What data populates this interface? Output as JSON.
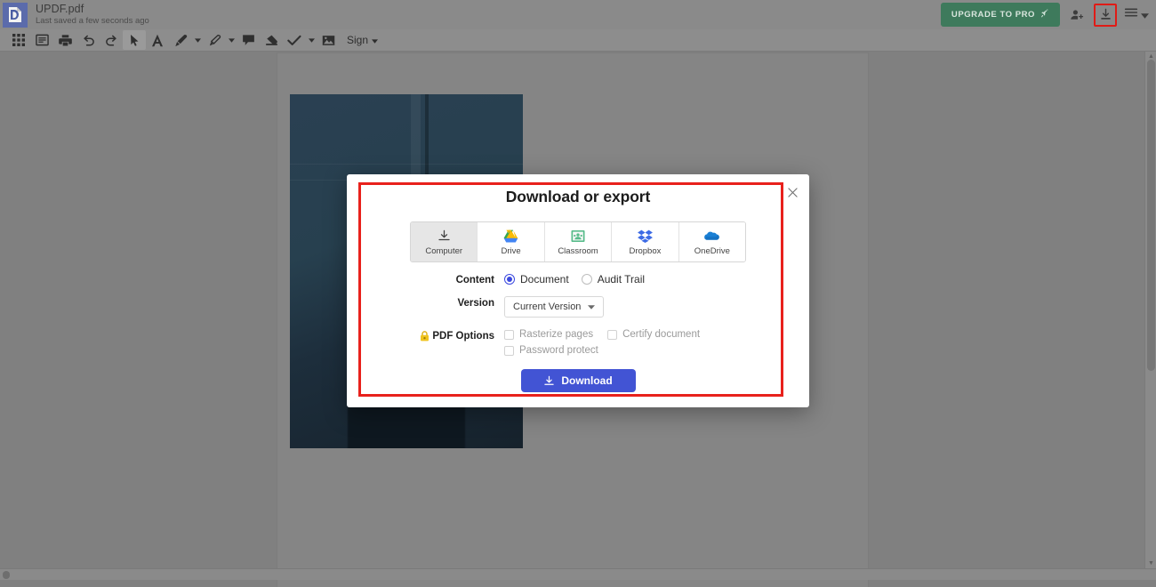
{
  "app": {
    "logo_icon": "dochub-logo-icon",
    "document_title": "UPDF.pdf",
    "save_status": "Last saved a few seconds ago",
    "upgrade_label": "UPGRADE TO PRO",
    "upgrade_icon": "rocket-icon",
    "upgrade_color": "#3e7a5c",
    "share_icon": "add-person-icon",
    "download_icon": "download-icon",
    "menu_icon": "hamburger-menu-icon",
    "menu_caret_icon": "chevron-down-icon",
    "highlight_color": "#e8211c"
  },
  "toolbar": {
    "items": [
      {
        "icon": "grid-thumbnails-icon",
        "label": "Page thumbnails",
        "selected": false,
        "caret": false
      },
      {
        "icon": "page-list-icon",
        "label": "Page list",
        "selected": false,
        "caret": false
      },
      {
        "icon": "printer-icon",
        "label": "Print",
        "selected": false,
        "caret": false
      },
      {
        "icon": "undo-icon",
        "label": "Undo",
        "selected": false,
        "caret": false
      },
      {
        "icon": "redo-icon",
        "label": "Redo",
        "selected": false,
        "caret": false
      },
      {
        "icon": "cursor-arrow-icon",
        "label": "Select",
        "selected": true,
        "caret": false
      },
      {
        "icon": "text-tool-icon",
        "label": "Text",
        "selected": false,
        "caret": false
      },
      {
        "icon": "marker-pen-icon",
        "label": "Draw",
        "selected": false,
        "caret": true
      },
      {
        "icon": "highlighter-icon",
        "label": "Highlight",
        "selected": false,
        "caret": true
      },
      {
        "icon": "comment-icon",
        "label": "Comment",
        "selected": false,
        "caret": false
      },
      {
        "icon": "eraser-icon",
        "label": "Whiteout",
        "selected": false,
        "caret": false
      },
      {
        "icon": "checkmark-icon",
        "label": "Check",
        "selected": false,
        "caret": true
      },
      {
        "icon": "image-icon",
        "label": "Image",
        "selected": false,
        "caret": false
      }
    ],
    "sign_label": "Sign",
    "sign_caret_icon": "chevron-down-icon"
  },
  "zoom_rail": {
    "zoom_in_icon": "zoom-in-magnifier-icon",
    "zoom_out_icon": "zoom-out-magnifier-icon"
  },
  "modal": {
    "title": "Download or export",
    "close_icon": "close-x-icon",
    "destinations": [
      {
        "label": "Computer",
        "icon": "download-to-computer-icon",
        "active": true
      },
      {
        "label": "Drive",
        "icon": "google-drive-icon",
        "active": false
      },
      {
        "label": "Classroom",
        "icon": "google-classroom-icon",
        "active": false
      },
      {
        "label": "Dropbox",
        "icon": "dropbox-icon",
        "active": false
      },
      {
        "label": "OneDrive",
        "icon": "onedrive-cloud-icon",
        "active": false
      }
    ],
    "content": {
      "label": "Content",
      "options": [
        {
          "label": "Document",
          "selected": true
        },
        {
          "label": "Audit Trail",
          "selected": false
        }
      ]
    },
    "version": {
      "label": "Version",
      "value": "Current Version",
      "caret_icon": "chevron-down-icon"
    },
    "pdf_options": {
      "label": "PDF Options",
      "lock_icon": "gold-lock-icon",
      "checkboxes": [
        {
          "label": "Rasterize pages",
          "checked": false,
          "disabled": true
        },
        {
          "label": "Certify document",
          "checked": false,
          "disabled": true
        },
        {
          "label": "Password protect",
          "checked": false,
          "disabled": true
        }
      ]
    },
    "submit": {
      "label": "Download",
      "icon": "download-icon",
      "color": "#4254d4"
    },
    "accent_radio_color": "#3b49df"
  },
  "document": {
    "page_image_alt": "dark blue photo of a person in a doorway"
  }
}
